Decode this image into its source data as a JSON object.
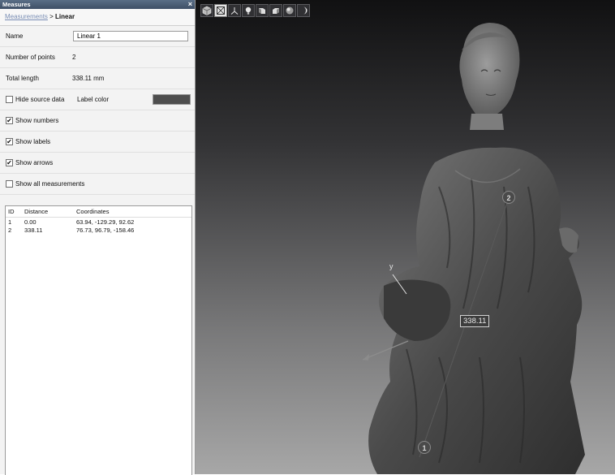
{
  "panel": {
    "title": "Measures",
    "close_glyph": "×",
    "breadcrumb": {
      "link": "Measurements",
      "separator": " > ",
      "current": "Linear"
    }
  },
  "fields": {
    "name_label": "Name",
    "name_value": "Linear 1",
    "points_label": "Number of points",
    "points_value": "2",
    "length_label": "Total length",
    "length_value": "338.11 mm",
    "label_color_label": "Label color",
    "label_color": "#4e4e4e"
  },
  "options": {
    "hide_source": {
      "label": "Hide source data",
      "checked": false
    },
    "show_numbers": {
      "label": "Show numbers",
      "checked": true
    },
    "show_labels": {
      "label": "Show labels",
      "checked": true
    },
    "show_arrows": {
      "label": "Show arrows",
      "checked": true
    },
    "show_all": {
      "label": "Show all measurements",
      "checked": false
    }
  },
  "table": {
    "headers": [
      "ID",
      "Distance",
      "Coordinates"
    ],
    "rows": [
      [
        "1",
        "0.00",
        "63.94, -129.29, 92.62"
      ],
      [
        "2",
        "338.11",
        "76.73, 96.79, -158.46"
      ]
    ]
  },
  "toolbar": {
    "buttons": [
      "view-cube-icon",
      "fit-view-icon",
      "axes-icon",
      "light-icon",
      "box-left-icon",
      "box-right-icon",
      "sphere-icon",
      "shade-icon"
    ]
  },
  "viewport": {
    "markers": [
      "1",
      "2"
    ],
    "distance_label": "338.11",
    "axis_label": "y"
  },
  "colors": {
    "panel_header": "#4a5d78",
    "link": "#7a8eb4",
    "viewport_bg_top": "#111112",
    "viewport_bg_bottom": "#a7a7a7"
  }
}
